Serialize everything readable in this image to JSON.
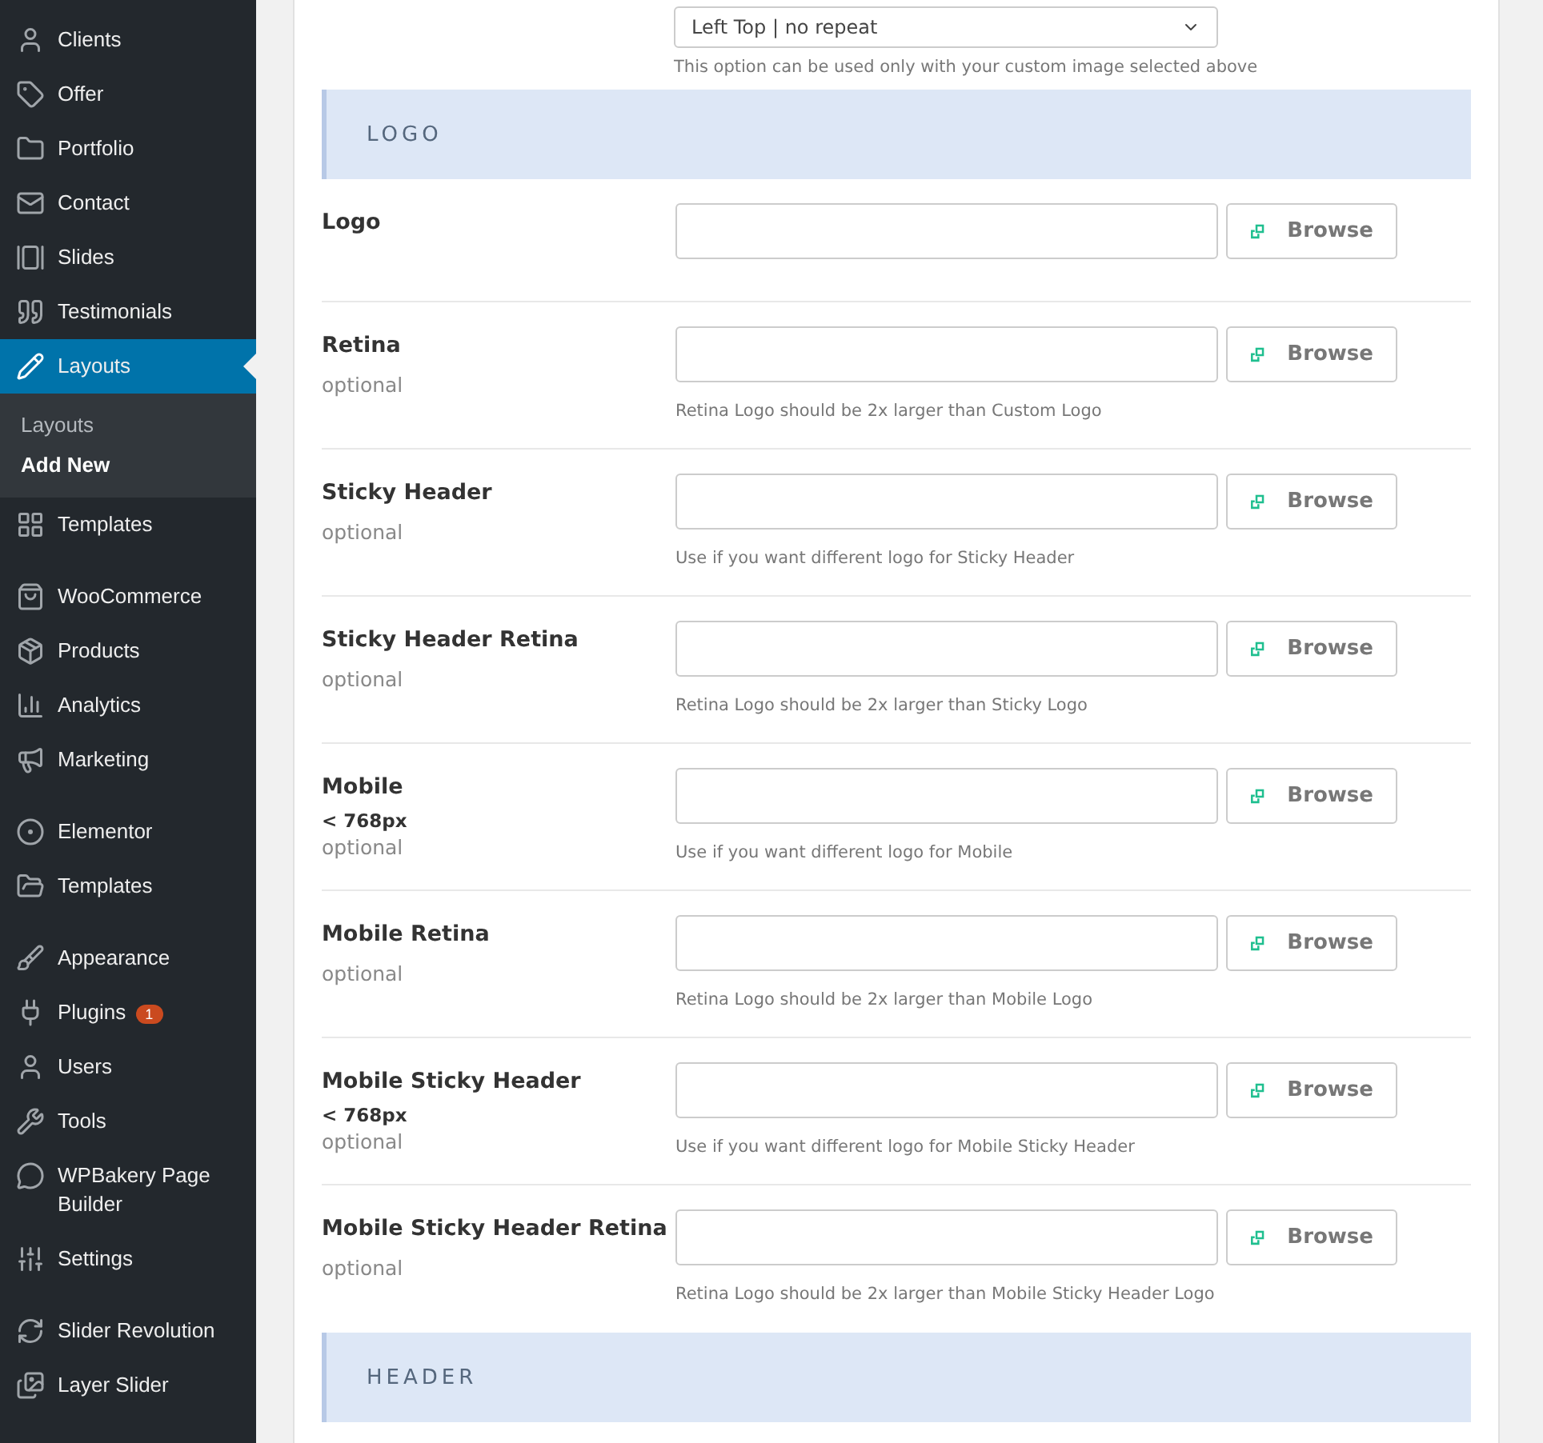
{
  "sidebar": {
    "groups": [
      [
        {
          "label": "Clients",
          "selected": false
        },
        {
          "label": "Offer",
          "selected": false
        },
        {
          "label": "Portfolio",
          "selected": false
        },
        {
          "label": "Contact",
          "selected": false
        },
        {
          "label": "Slides",
          "selected": false
        },
        {
          "label": "Testimonials",
          "selected": false
        },
        {
          "label": "Layouts",
          "selected": true,
          "children": [
            {
              "label": "Layouts",
              "selected": false
            },
            {
              "label": "Add New",
              "selected": true
            }
          ]
        },
        {
          "label": "Templates",
          "selected": false
        }
      ],
      [
        {
          "label": "WooCommerce",
          "selected": false
        },
        {
          "label": "Products",
          "selected": false
        },
        {
          "label": "Analytics",
          "selected": false
        },
        {
          "label": "Marketing",
          "selected": false
        }
      ],
      [
        {
          "label": "Elementor",
          "selected": false
        },
        {
          "label": "Templates",
          "selected": false
        }
      ],
      [
        {
          "label": "Appearance",
          "selected": false
        },
        {
          "label": "Plugins",
          "selected": false,
          "badge": "1"
        },
        {
          "label": "Users",
          "selected": false
        },
        {
          "label": "Tools",
          "selected": false
        },
        {
          "label": "WPBakery Page Builder",
          "selected": false
        },
        {
          "label": "Settings",
          "selected": false
        }
      ],
      [
        {
          "label": "Slider Revolution",
          "selected": false
        },
        {
          "label": "Layer Slider",
          "selected": false
        }
      ]
    ]
  },
  "background_position": {
    "value": "Left Top | no repeat",
    "hint": "This option can be used only with your custom image selected above"
  },
  "sections": [
    {
      "title": "LOGO",
      "fields": [
        {
          "label": "Logo",
          "button": "Browse"
        },
        {
          "label": "Retina",
          "optional": "optional",
          "button": "Browse",
          "hint": "Retina Logo should be 2x larger than Custom Logo"
        },
        {
          "label": "Sticky Header",
          "optional": "optional",
          "button": "Browse",
          "hint": "Use if you want different logo for Sticky Header"
        },
        {
          "label": "Sticky Header Retina",
          "optional": "optional",
          "button": "Browse",
          "hint": "Retina Logo should be 2x larger than Sticky Logo"
        },
        {
          "label": "Mobile",
          "breakpoint": "< 768px",
          "optional": "optional",
          "button": "Browse",
          "hint": "Use if you want different logo for Mobile"
        },
        {
          "label": "Mobile Retina",
          "optional": "optional",
          "button": "Browse",
          "hint": "Retina Logo should be 2x larger than Mobile Logo"
        },
        {
          "label": "Mobile Sticky Header",
          "breakpoint": "< 768px",
          "optional": "optional",
          "button": "Browse",
          "hint": "Use if you want different logo for Mobile Sticky Header"
        },
        {
          "label": "Mobile Sticky Header Retina",
          "optional": "optional",
          "button": "Browse",
          "hint": "Retina Logo should be 2x larger than Mobile Sticky Header Logo"
        }
      ]
    },
    {
      "title": "HEADER"
    }
  ]
}
